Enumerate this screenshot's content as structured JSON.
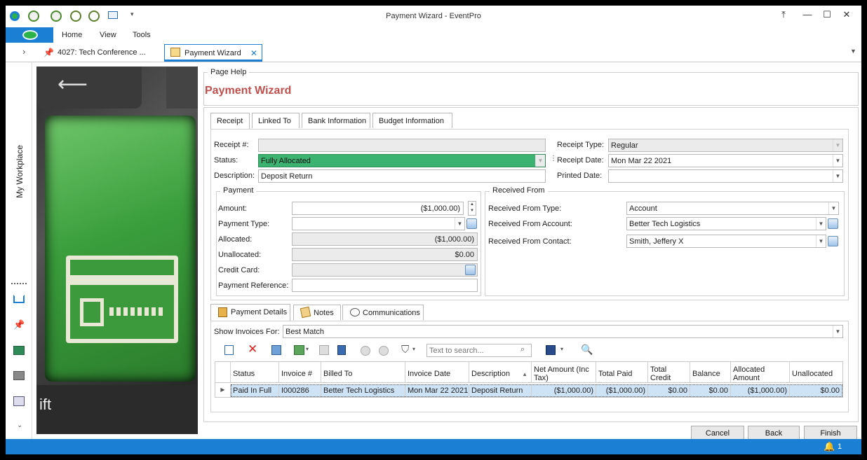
{
  "window": {
    "title": "Payment Wizard - EventPro"
  },
  "ribbon": {
    "tabs": [
      "Home",
      "View",
      "Tools"
    ]
  },
  "doc_tabs": [
    {
      "label": "4027: Tech Conference ..."
    },
    {
      "label": "Payment Wizard"
    }
  ],
  "left_rail": {
    "label": "My Workplace"
  },
  "page_help": {
    "legend": "Page Help",
    "title": "Payment Wizard"
  },
  "tabs": [
    "Receipt",
    "Linked To",
    "Bank Information",
    "Budget Information"
  ],
  "receipt": {
    "receipt_no_label": "Receipt #:",
    "receipt_no": "",
    "status_label": "Status:",
    "status": "Fully Allocated",
    "description_label": "Description:",
    "description": "Deposit Return",
    "receipt_type_label": "Receipt Type:",
    "receipt_type": "Regular",
    "receipt_date_label": "Receipt Date:",
    "receipt_date": "Mon Mar 22 2021",
    "printed_date_label": "Printed Date:",
    "printed_date": ""
  },
  "payment": {
    "legend": "Payment",
    "amount_label": "Amount:",
    "amount": "($1,000.00)",
    "payment_type_label": "Payment Type:",
    "payment_type": "",
    "allocated_label": "Allocated:",
    "allocated": "($1,000.00)",
    "unallocated_label": "Unallocated:",
    "unallocated": "$0.00",
    "credit_card_label": "Credit Card:",
    "credit_card": "",
    "reference_label": "Payment Reference:",
    "reference": ""
  },
  "received_from": {
    "legend": "Received From",
    "type_label": "Received From Type:",
    "type": "Account",
    "account_label": "Received From Account:",
    "account": "Better Tech Logistics",
    "contact_label": "Received From Contact:",
    "contact": "Smith, Jeffery X"
  },
  "detail_tabs": [
    "Payment Details",
    "Notes",
    "Communications"
  ],
  "invoices": {
    "show_label": "Show Invoices For:",
    "show_value": "Best Match",
    "search_placeholder": "Text to search...",
    "columns": [
      "Status",
      "Invoice #",
      "Billed To",
      "Invoice Date",
      "Description",
      "Net Amount (Inc Tax)",
      "Total Paid",
      "Total Credit",
      "Balance",
      "Allocated Amount",
      "Unallocated"
    ],
    "rows": [
      [
        "Paid In Full",
        "I000286",
        "Better Tech Logistics",
        "Mon Mar 22 2021",
        "Deposit Return",
        "($1,000.00)",
        "($1,000.00)",
        "$0.00",
        "$0.00",
        "($1,000.00)",
        "$0.00"
      ]
    ]
  },
  "footer": {
    "cancel": "Cancel",
    "back": "Back",
    "finish": "Finish"
  },
  "statusbar": {
    "alerts": "1"
  }
}
